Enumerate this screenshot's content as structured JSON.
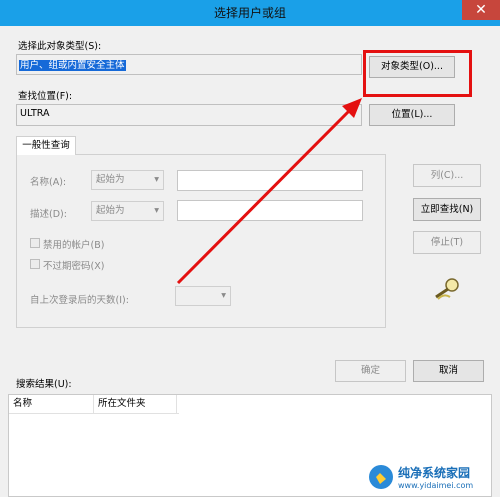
{
  "window": {
    "title": "选择用户或组",
    "close_glyph": "✕"
  },
  "object_type": {
    "label": "选择此对象类型(S):",
    "value": "用户、组或内置安全主体",
    "button": "对象类型(O)..."
  },
  "location": {
    "label": "查找位置(F):",
    "value": "ULTRA",
    "button": "位置(L)..."
  },
  "query": {
    "tab": "一般性查询",
    "name_label": "名称(A):",
    "name_mode": "起始为",
    "desc_label": "描述(D):",
    "desc_mode": "起始为",
    "disabled_accounts": "禁用的帐户(B)",
    "no_expire": "不过期密码(X)",
    "days_label": "自上次登录后的天数(I):"
  },
  "buttons": {
    "columns": "列(C)...",
    "find_now": "立即查找(N)",
    "stop": "停止(T)",
    "ok": "确定",
    "cancel": "取消"
  },
  "results": {
    "label": "搜索结果(U):",
    "columns": [
      "名称",
      "所在文件夹"
    ]
  },
  "icons": {
    "dropdown": "▾"
  },
  "watermark": {
    "name": "纯净系统家园",
    "url": "www.yidaimei.com"
  },
  "colors": {
    "titlebar": "#1aa0e8",
    "annotation": "#e41010",
    "selection": "#1569d8"
  }
}
